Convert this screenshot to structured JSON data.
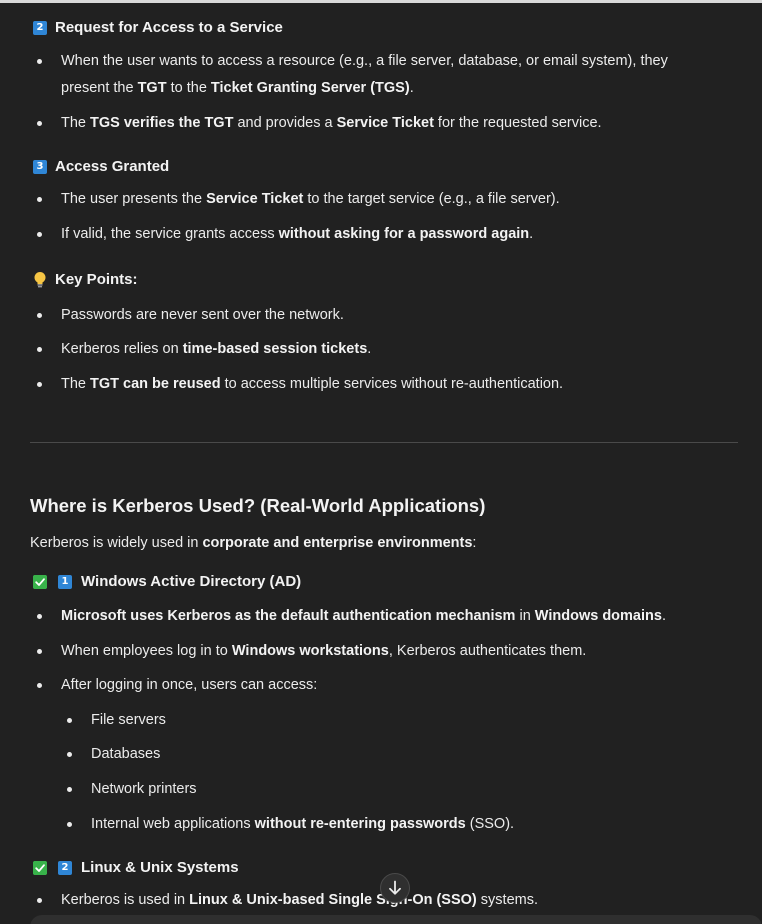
{
  "section2": {
    "num": "2",
    "title": "Request for Access to a Service",
    "b1": {
      "t1": "When the user wants to access a resource (e.g., a file server, database, or email system), they",
      "t2": "present the ",
      "b_tgt": "TGT",
      "t3": " to the ",
      "b_tgs": "Ticket Granting Server (TGS)",
      "t4": "."
    },
    "b2": {
      "t1": "The ",
      "b1": "TGS verifies the TGT",
      "t2": " and provides a ",
      "b2": "Service Ticket",
      "t3": " for the requested service."
    }
  },
  "section3": {
    "num": "3",
    "title": "Access Granted",
    "b1": {
      "t1": "The user presents the ",
      "b1": "Service Ticket",
      "t2": " to the target service (e.g., a file server)."
    },
    "b2": {
      "t1": "If valid, the service grants access ",
      "b1": "without asking for a password again",
      "t2": "."
    }
  },
  "keypoints": {
    "title": "Key Points:",
    "b1": "Passwords are never sent over the network.",
    "b2": {
      "t1": "Kerberos relies on ",
      "b1": "time-based session tickets",
      "t2": "."
    },
    "b3": {
      "t1": "The ",
      "b1": "TGT can be reused",
      "t2": " to access multiple services without re-authentication."
    }
  },
  "where": {
    "title": "Where is Kerberos Used? (Real-World Applications)",
    "intro": {
      "t1": "Kerberos is widely used in ",
      "b1": "corporate and enterprise environments",
      "t2": ":"
    },
    "ad": {
      "num": "1",
      "title": "Windows Active Directory (AD)",
      "b1": {
        "b1": "Microsoft uses Kerberos as the default authentication mechanism",
        "t1": " in ",
        "b2": "Windows domains",
        "t2": "."
      },
      "b2": {
        "t1": "When employees log in to ",
        "b1": "Windows workstations",
        "t2": ", Kerberos authenticates them."
      },
      "b3": "After logging in once, users can access:",
      "sub": {
        "s1": "File servers",
        "s2": "Databases",
        "s3": "Network printers",
        "s4": {
          "t1": "Internal web applications ",
          "b1": "without re-entering passwords",
          "t2": " (SSO)."
        }
      }
    },
    "linux": {
      "num": "2",
      "title": "Linux & Unix Systems",
      "b1": {
        "t1": "Kerberos is used in ",
        "b1": "Linux & Unix-based Single Sign-On (SSO)",
        "t2": " systems."
      }
    }
  },
  "colors": {
    "background": "#212121",
    "text": "#ececec",
    "number_badge": "#2f86d6",
    "check_badge": "#38b24a"
  },
  "icons": [
    "keycap-number-icon",
    "light-bulb-icon",
    "check-mark-icon",
    "arrow-down-icon"
  ]
}
